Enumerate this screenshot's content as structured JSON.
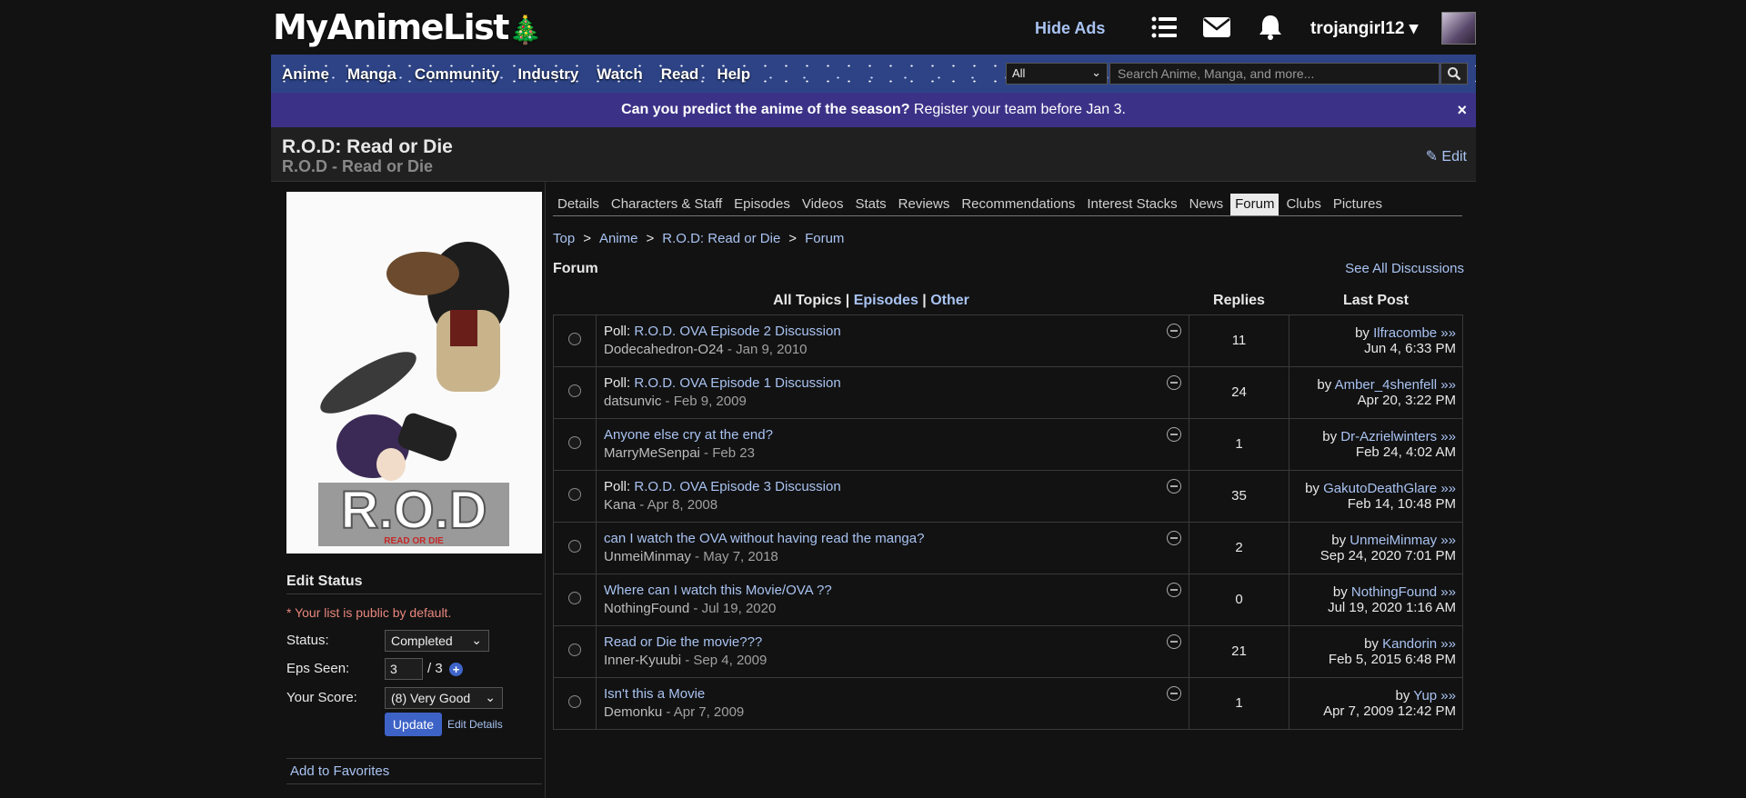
{
  "header": {
    "logo": "MyAnimeList",
    "hide_ads": "Hide Ads",
    "username": "trojangirl12",
    "icons": [
      "list-icon",
      "mail-icon",
      "bell-icon",
      "caret-down-icon"
    ]
  },
  "nav": {
    "items": [
      "Anime",
      "Manga",
      "Community",
      "Industry",
      "Watch",
      "Read",
      "Help"
    ],
    "search_type": "All",
    "search_placeholder": "Search Anime, Manga, and more..."
  },
  "banner": {
    "bold": "Can you predict the anime of the season?",
    "rest": " Register your team before Jan 3.",
    "close": "×"
  },
  "title": {
    "main": "R.O.D: Read or Die",
    "sub": "R.O.D - Read or Die",
    "edit": "Edit"
  },
  "cover": {
    "text": "R.O.D",
    "sub": "READ OR DIE"
  },
  "edit_status": {
    "heading": "Edit Status",
    "note": "* Your list is public by default.",
    "status_label": "Status:",
    "status_value": "Completed",
    "eps_label": "Eps Seen:",
    "eps_value": "3",
    "eps_total": "/ 3",
    "score_label": "Your Score:",
    "score_value": "(8) Very Good",
    "update": "Update",
    "edit_details": "Edit Details",
    "favorites": "Add to Favorites"
  },
  "tabs": [
    "Details",
    "Characters & Staff",
    "Episodes",
    "Videos",
    "Stats",
    "Reviews",
    "Recommendations",
    "Interest Stacks",
    "News",
    "Forum",
    "Clubs",
    "Pictures"
  ],
  "active_tab": "Forum",
  "breadcrumb": [
    "Top",
    "Anime",
    "R.O.D: Read or Die",
    "Forum"
  ],
  "forum": {
    "heading": "Forum",
    "see_all": "See All Discussions",
    "col_all": "All Topics",
    "col_episodes": "Episodes",
    "col_other": "Other",
    "col_replies": "Replies",
    "col_last": "Last Post",
    "topics": [
      {
        "prefix": "Poll: ",
        "title": "R.O.D. OVA Episode 2 Discussion",
        "author": "Dodecahedron-O24",
        "date": "Jan 9, 2010",
        "replies": "11",
        "last_user": "Ilfracombe »»",
        "last_date": "Jun 4, 6:33 PM"
      },
      {
        "prefix": "Poll: ",
        "title": "R.O.D. OVA Episode 1 Discussion",
        "author": "datsunvic",
        "date": "Feb 9, 2009",
        "replies": "24",
        "last_user": "Amber_4shenfell »»",
        "last_date": "Apr 20, 3:22 PM"
      },
      {
        "prefix": "",
        "title": "Anyone else cry at the end?",
        "author": "MarryMeSenpai",
        "date": "Feb 23",
        "replies": "1",
        "last_user": "Dr-Azrielwinters »»",
        "last_date": "Feb 24, 4:02 AM"
      },
      {
        "prefix": "Poll: ",
        "title": "R.O.D. OVA Episode 3 Discussion",
        "author": "Kana",
        "date": "Apr 8, 2008",
        "replies": "35",
        "last_user": "GakutoDeathGlare »»",
        "last_date": "Feb 14, 10:48 PM"
      },
      {
        "prefix": "",
        "title": "can I watch the OVA without having read the manga?",
        "author": "UnmeiMinmay",
        "date": "May 7, 2018",
        "replies": "2",
        "last_user": "UnmeiMinmay »»",
        "last_date": "Sep 24, 2020 7:01 PM"
      },
      {
        "prefix": "",
        "title": "Where can I watch this Movie/OVA ??",
        "author": "NothingFound",
        "date": "Jul 19, 2020",
        "replies": "0",
        "last_user": "NothingFound »»",
        "last_date": "Jul 19, 2020 1:16 AM"
      },
      {
        "prefix": "",
        "title": "Read or Die the movie???",
        "author": "Inner-Kyuubi",
        "date": "Sep 4, 2009",
        "replies": "21",
        "last_user": "Kandorin »»",
        "last_date": "Feb 5, 2015 6:48 PM"
      },
      {
        "prefix": "",
        "title": "Isn't this a Movie",
        "author": "Demonku",
        "date": "Apr 7, 2009",
        "replies": "1",
        "last_user": "Yup »»",
        "last_date": "Apr 7, 2009 12:42 PM"
      }
    ]
  },
  "colors": {
    "background": "#121212",
    "link": "#a9c3f2",
    "nav": "#2d4386",
    "banner": "#3b3288",
    "button": "#3e63c7"
  }
}
